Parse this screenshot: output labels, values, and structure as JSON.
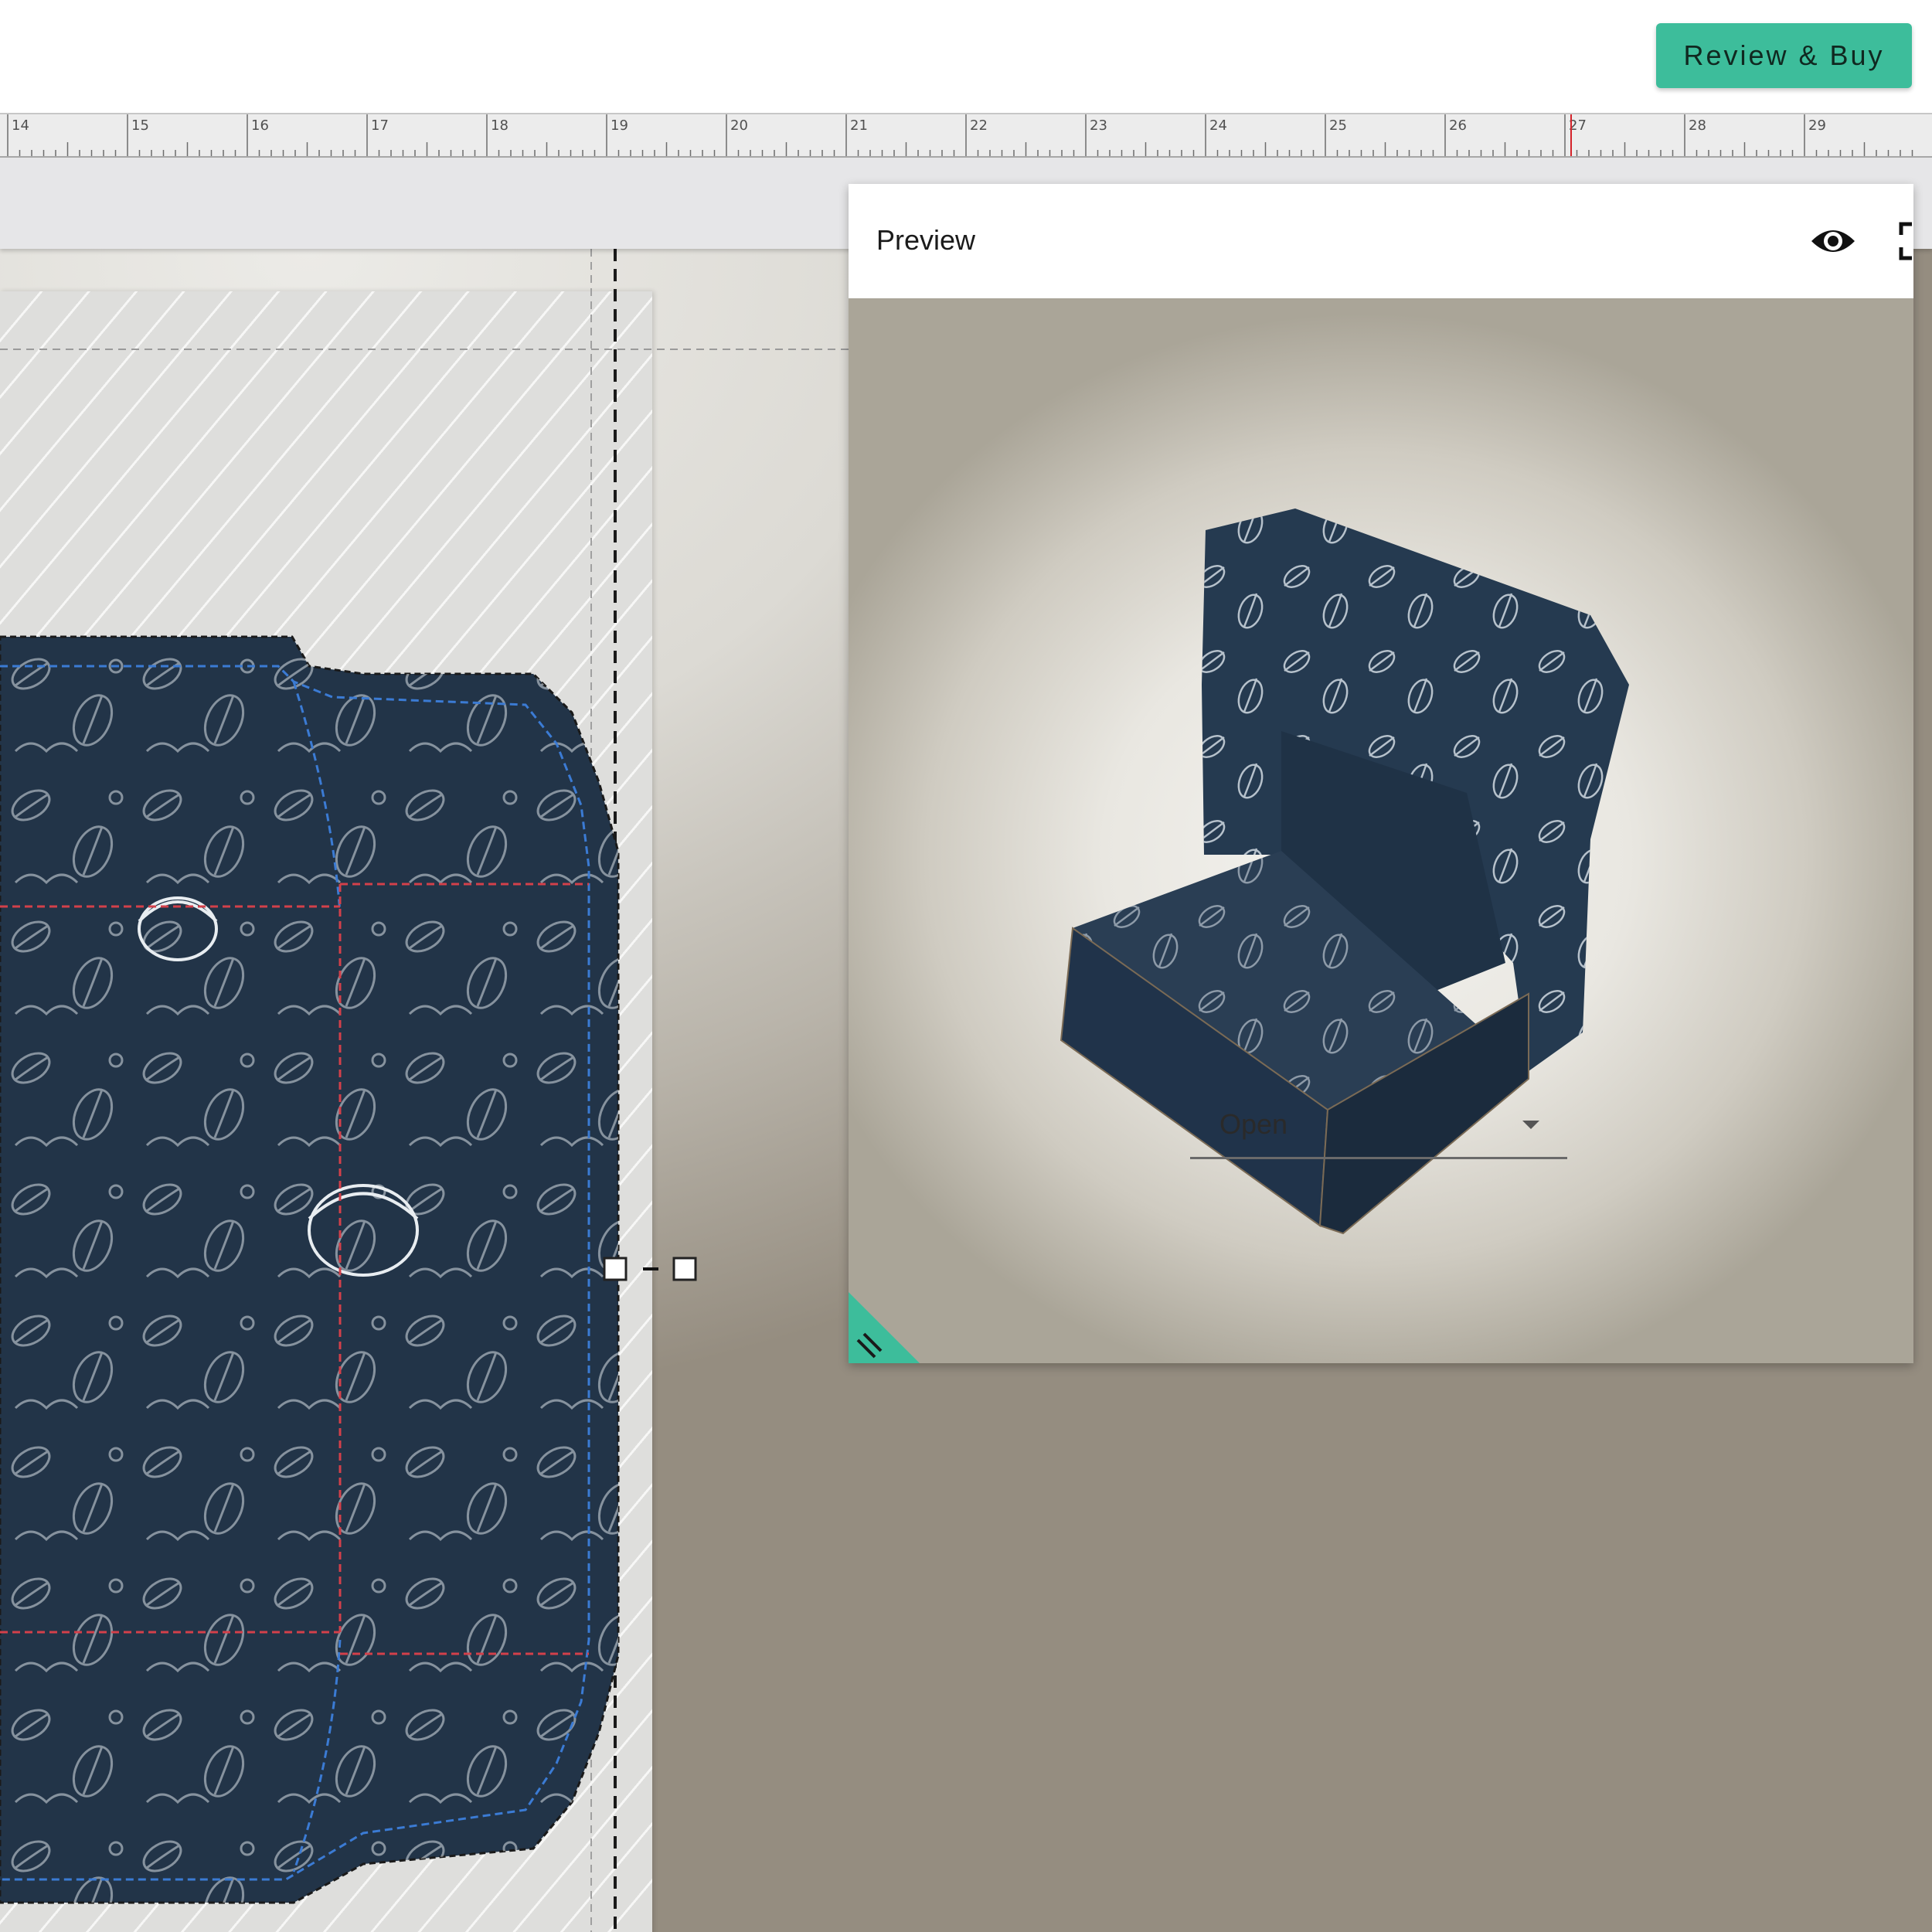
{
  "header": {
    "review_buy_label": "Review & Buy"
  },
  "ruler": {
    "labels": [
      "14",
      "15",
      "16",
      "17",
      "18",
      "19",
      "20",
      "21",
      "22",
      "23",
      "24",
      "25",
      "26",
      "27",
      "28",
      "29"
    ]
  },
  "preview": {
    "title": "Preview",
    "view_mode_selected": "Open",
    "icons": [
      "eye-icon",
      "fullscreen-icon",
      "resize-handle-icon"
    ]
  },
  "colors": {
    "accent": "#3dbd9b",
    "box_navy": "#223448",
    "bleed_line": "#3b7bd4",
    "fold_line": "#d3404a"
  }
}
